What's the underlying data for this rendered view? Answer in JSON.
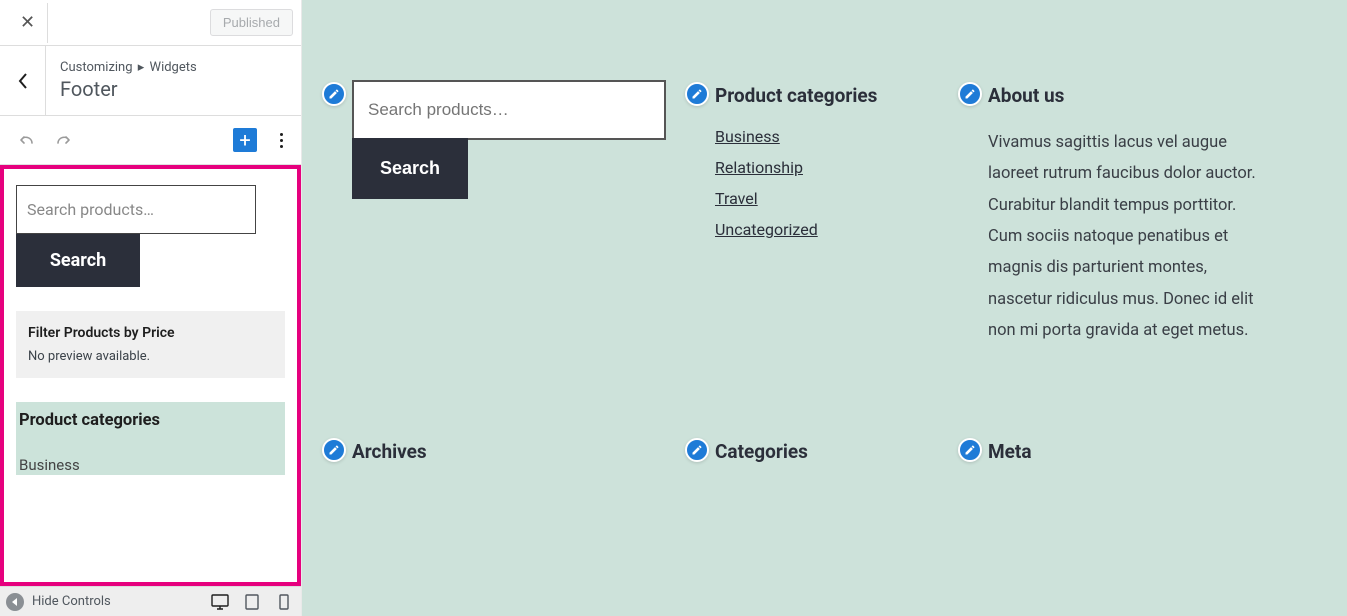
{
  "topbar": {
    "publish_label": "Published"
  },
  "breadcrumb": {
    "root": "Customizing",
    "section": "Widgets",
    "title": "Footer"
  },
  "footer_bar": {
    "hide_label": "Hide Controls"
  },
  "sidebar_blocks": {
    "search": {
      "placeholder": "Search products…",
      "button": "Search"
    },
    "filter": {
      "title": "Filter Products by Price",
      "no_preview": "No preview available."
    },
    "categories": {
      "title": "Product categories",
      "first_item": "Business"
    }
  },
  "preview": {
    "search": {
      "placeholder": "Search products…",
      "button": "Search"
    },
    "product_categories": {
      "title": "Product categories",
      "items": [
        "Business",
        "Relationship",
        "Travel",
        "Uncategorized"
      ]
    },
    "about": {
      "title": "About us",
      "body": "Vivamus sagittis lacus vel augue laoreet rutrum faucibus dolor auctor. Curabitur blandit tempus porttitor. Cum sociis natoque penatibus et magnis dis parturient montes, nascetur ridiculus mus. Donec id elit non mi porta gravida at eget metus."
    },
    "row2": {
      "archives": "Archives",
      "categories": "Categories",
      "meta": "Meta"
    }
  },
  "colors": {
    "accent": "#1e7bd7",
    "highlight": "#e6007e",
    "dark": "#2b2f3a",
    "preview_bg": "#cde2da"
  }
}
